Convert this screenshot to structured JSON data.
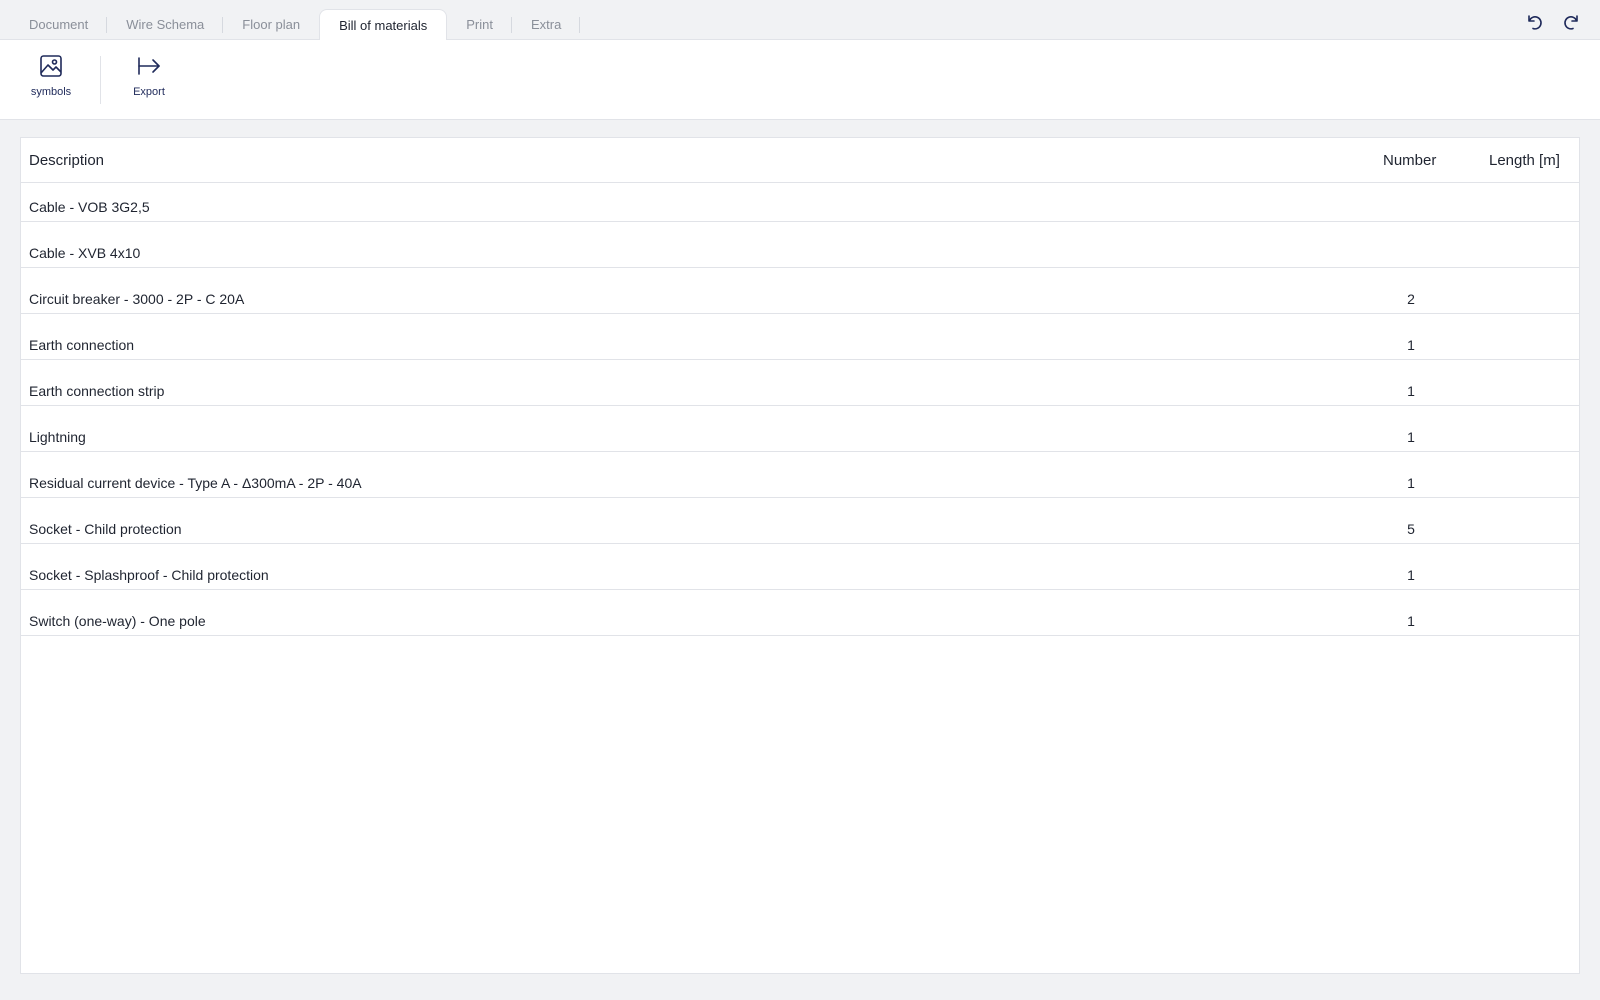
{
  "tabs": [
    {
      "label": "Document",
      "active": false
    },
    {
      "label": "Wire Schema",
      "active": false
    },
    {
      "label": "Floor plan",
      "active": false
    },
    {
      "label": "Bill of materials",
      "active": true
    },
    {
      "label": "Print",
      "active": false
    },
    {
      "label": "Extra",
      "active": false
    }
  ],
  "toolbar": {
    "symbols_label": "symbols",
    "export_label": "Export"
  },
  "table": {
    "headers": {
      "description": "Description",
      "number": "Number",
      "length": "Length [m]"
    },
    "rows": [
      {
        "description": "Cable - VOB 3G2,5",
        "number": "",
        "length": ""
      },
      {
        "description": "Cable - XVB 4x10",
        "number": "",
        "length": ""
      },
      {
        "description": "Circuit breaker - 3000 - 2P - C 20A",
        "number": "2",
        "length": ""
      },
      {
        "description": "Earth connection",
        "number": "1",
        "length": ""
      },
      {
        "description": "Earth connection strip",
        "number": "1",
        "length": ""
      },
      {
        "description": "Lightning",
        "number": "1",
        "length": ""
      },
      {
        "description": "Residual current device - Type A - Δ300mA - 2P - 40A",
        "number": "1",
        "length": ""
      },
      {
        "description": "Socket - Child protection",
        "number": "5",
        "length": ""
      },
      {
        "description": "Socket - Splashproof - Child protection",
        "number": "1",
        "length": ""
      },
      {
        "description": "Switch (one-way) - One pole",
        "number": "1",
        "length": ""
      }
    ]
  },
  "icons": {
    "undo": "undo-icon",
    "redo": "redo-icon",
    "symbols": "image-icon",
    "export": "export-arrow-icon"
  },
  "colors": {
    "accent": "#1f2a5a",
    "background": "#f1f2f4",
    "surface": "#ffffff",
    "border": "#e1e3e8",
    "muted_text": "#8a8f99"
  }
}
